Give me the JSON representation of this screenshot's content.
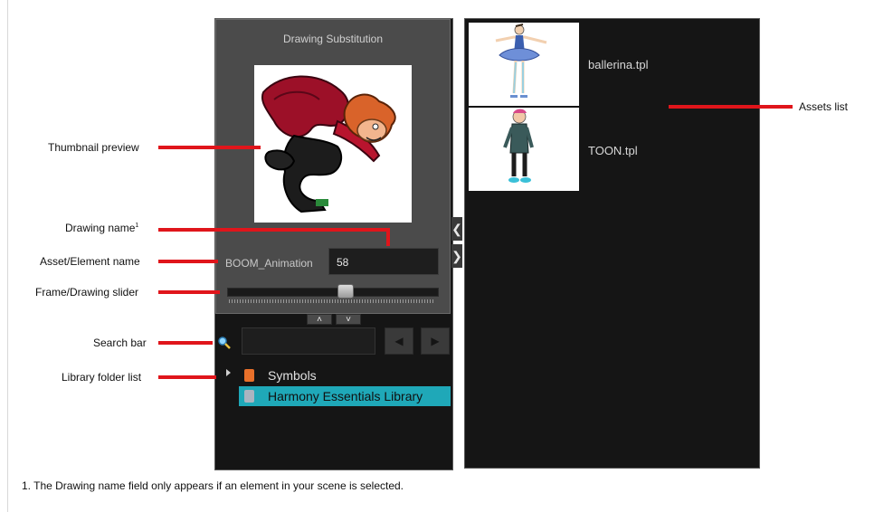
{
  "panel": {
    "title": "Drawing Substitution",
    "asset_element_name": "BOOM_Animation",
    "drawing_name": "58",
    "slider_level": 0.57,
    "library": [
      {
        "label": "Symbols",
        "selected": false,
        "icon": "symbol-folder-icon"
      },
      {
        "label": "Harmony Essentials Library",
        "selected": true,
        "icon": "library-folder-icon"
      }
    ],
    "assets": [
      {
        "name": "ballerina.tpl"
      },
      {
        "name": "TOON.tpl"
      }
    ]
  },
  "callouts": {
    "thumbnail_preview": "Thumbnail preview",
    "drawing_name": "Drawing name",
    "drawing_name_sup": "1",
    "asset_element_name": "Asset/Element name",
    "frame_drawing_slider": "Frame/Drawing slider",
    "search_bar": "Search bar",
    "library_folder_list": "Library folder list",
    "assets_list": "Assets list"
  },
  "footnote": "1. The Drawing name field only appears if an element in your scene is selected.",
  "colors": {
    "callout_line": "#e0151b",
    "selected_row": "#1fa8b8",
    "panel_dark": "#151515",
    "panel_gray": "#4b4b4b"
  }
}
